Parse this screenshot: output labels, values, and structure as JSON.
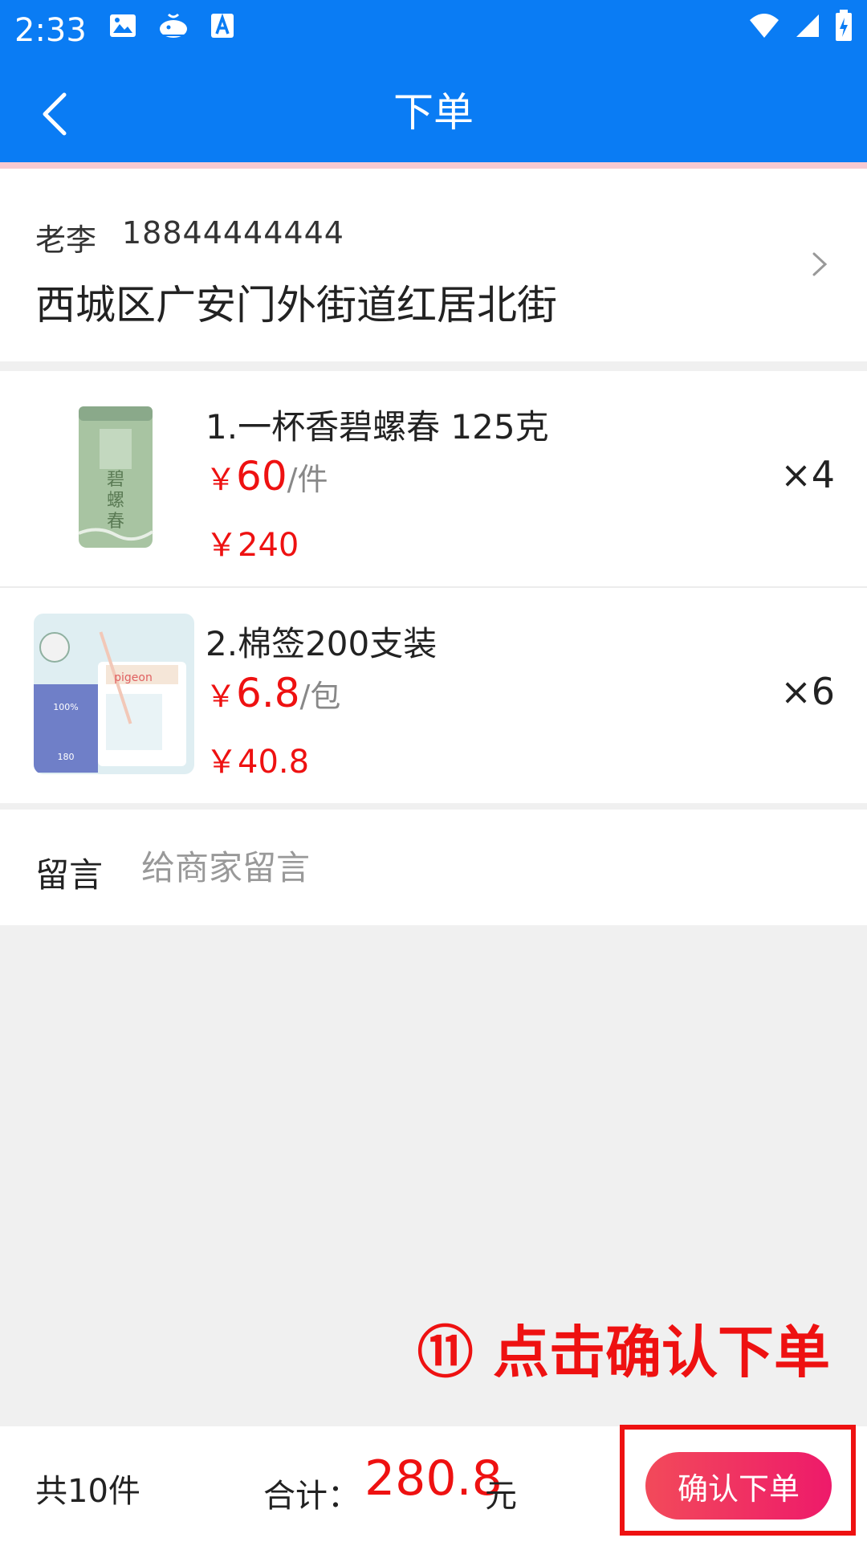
{
  "status_bar": {
    "time": "2:33"
  },
  "header": {
    "title": "下单"
  },
  "address": {
    "name": "老李",
    "phone": "18844444444",
    "line": "西城区广安门外街道红居北街"
  },
  "products": [
    {
      "title": "1.一杯香碧螺春 125克",
      "currency": "￥",
      "unit_price": "60",
      "unit": "/件",
      "line_total": "￥240",
      "quantity": "×4",
      "image": "tea-can"
    },
    {
      "title": "2.棉签200支装",
      "currency": "￥",
      "unit_price": "6.8",
      "unit": "/包",
      "line_total": "￥40.8",
      "quantity": "×6",
      "image": "cotton-swabs"
    }
  ],
  "message": {
    "label": "留言",
    "placeholder": "给商家留言"
  },
  "annotation": {
    "text": "⑪ 点击确认下单"
  },
  "bottom_bar": {
    "count": "共10件",
    "total_label": "合计：",
    "total_value": "280.8",
    "total_unit": "元",
    "confirm_label": "确认下单"
  },
  "colors": {
    "primary": "#0a7cf4",
    "price": "#ee1111",
    "button": "#f03a62"
  }
}
